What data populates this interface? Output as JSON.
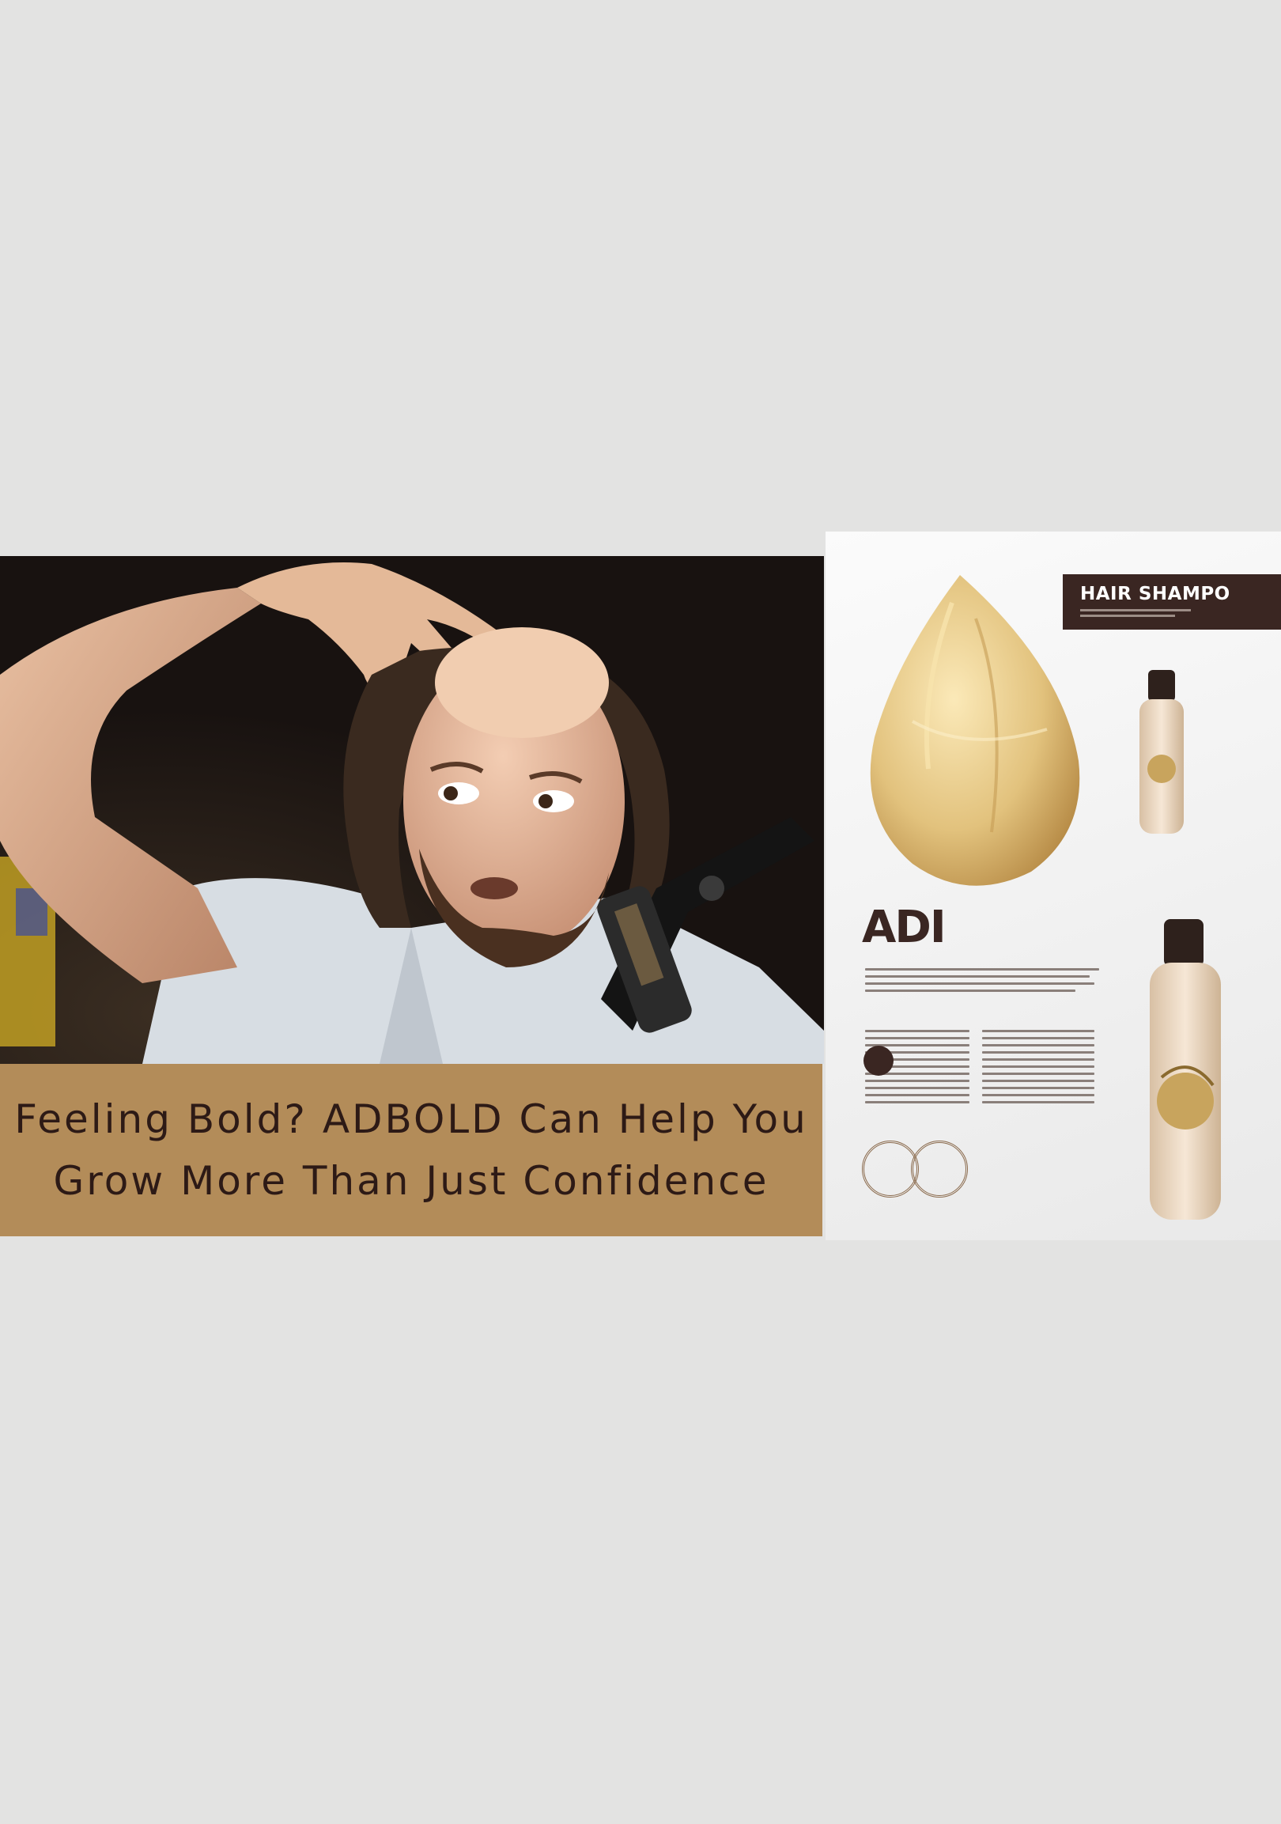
{
  "caption": {
    "line1": "Feeling Bold? ADBOLD Can Help You",
    "line2": "Grow More Than Just Confidence"
  },
  "ad": {
    "header_title": "HAIR SHAMPO",
    "brand": "ADI"
  },
  "colors": {
    "background": "#e3e3e2",
    "caption_band": "#b38c59",
    "caption_text": "#2d1a16",
    "header_bg": "#3a2622",
    "hair_gold": "#e2c27d"
  }
}
